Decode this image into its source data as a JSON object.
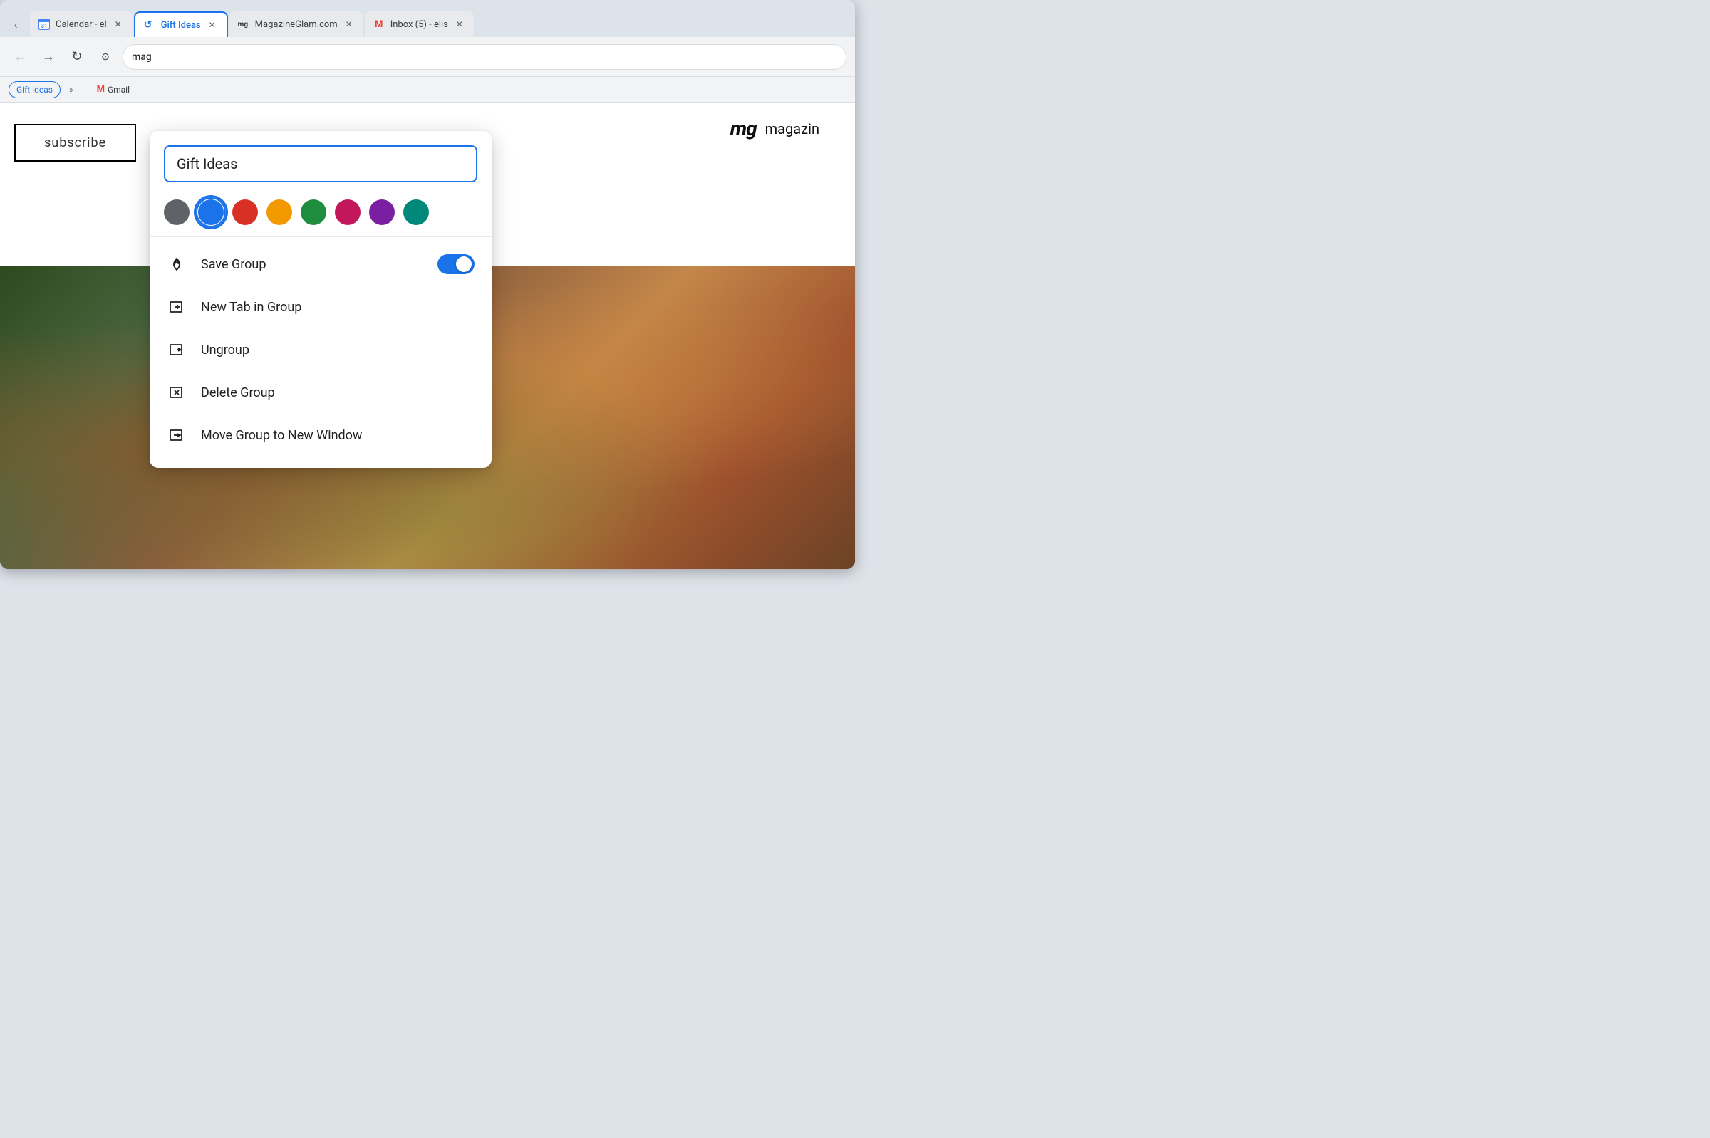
{
  "browser": {
    "tabs": [
      {
        "id": "calendar",
        "favicon_type": "calendar",
        "title": "Calendar - el",
        "active": false
      },
      {
        "id": "gift-ideas",
        "favicon_type": "bolt",
        "title": "Gift Ideas",
        "active": true
      },
      {
        "id": "magazine",
        "favicon_type": "mg",
        "title": "MagazineGlam.com",
        "active": false
      },
      {
        "id": "gmail",
        "favicon_type": "gmail",
        "title": "Inbox (5) - elis",
        "active": false
      }
    ],
    "address_bar": {
      "url": "mag"
    },
    "bookmarks": [
      {
        "label": "Gift ideas",
        "type": "chip"
      },
      {
        "label": "»",
        "type": "more"
      },
      {
        "label": "Gmail",
        "type": "gmail"
      }
    ]
  },
  "page": {
    "subscribe_label": "subscribe",
    "mg_logo": "mg",
    "magazine_label": "magazin"
  },
  "popup": {
    "name_input_value": "Gift Ideas",
    "name_input_placeholder": "Gift Ideas",
    "colors": [
      {
        "id": "grey",
        "hex": "#5f6368",
        "selected": false
      },
      {
        "id": "blue",
        "hex": "#1a73e8",
        "selected": true
      },
      {
        "id": "red",
        "hex": "#d93025",
        "selected": false
      },
      {
        "id": "orange",
        "hex": "#f29900",
        "selected": false
      },
      {
        "id": "green",
        "hex": "#1e8e3e",
        "selected": false
      },
      {
        "id": "pink",
        "hex": "#c2185b",
        "selected": false
      },
      {
        "id": "purple",
        "hex": "#7b1fa2",
        "selected": false
      },
      {
        "id": "teal",
        "hex": "#00897b",
        "selected": false
      }
    ],
    "menu_items": [
      {
        "id": "save-group",
        "icon": "save-group-icon",
        "label": "Save Group",
        "has_toggle": true,
        "toggle_on": true
      },
      {
        "id": "new-tab",
        "icon": "new-tab-icon",
        "label": "New Tab in Group",
        "has_toggle": false
      },
      {
        "id": "ungroup",
        "icon": "ungroup-icon",
        "label": "Ungroup",
        "has_toggle": false
      },
      {
        "id": "delete-group",
        "icon": "delete-group-icon",
        "label": "Delete Group",
        "has_toggle": false
      },
      {
        "id": "move-group",
        "icon": "move-group-icon",
        "label": "Move Group to New Window",
        "has_toggle": false
      }
    ]
  }
}
